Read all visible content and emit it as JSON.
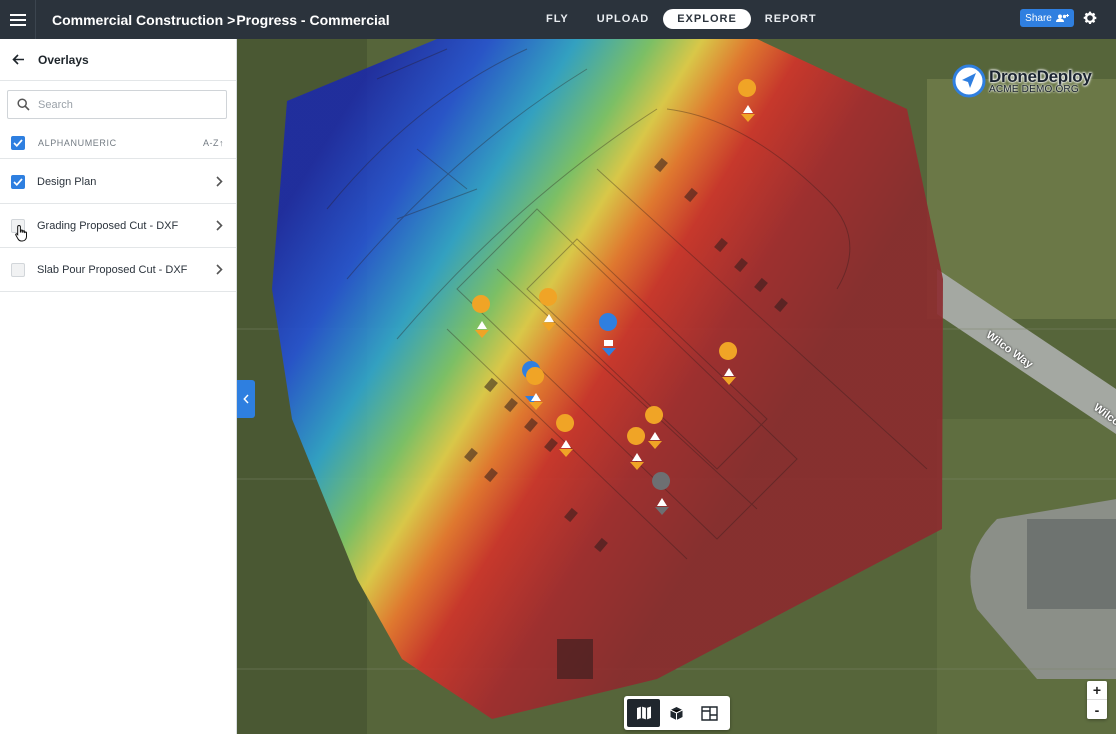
{
  "header": {
    "project": "Commercial Construction",
    "separator": ">",
    "page": "Progress - Commercial",
    "tabs": [
      {
        "label": "FLY",
        "active": false
      },
      {
        "label": "UPLOAD",
        "active": false
      },
      {
        "label": "EXPLORE",
        "active": true
      },
      {
        "label": "REPORT",
        "active": false
      }
    ],
    "share_label": "Share",
    "accent_color": "#2f7fe0"
  },
  "sidebar": {
    "title": "Overlays",
    "search_placeholder": "Search",
    "sort": {
      "label": "ALPHANUMERIC",
      "order": "A-Z",
      "checked": true
    },
    "overlays": [
      {
        "label": "Design Plan",
        "checked": true
      },
      {
        "label": "Grading Proposed Cut - DXF",
        "checked": false
      },
      {
        "label": "Slab Pour Proposed Cut - DXF",
        "checked": false
      }
    ]
  },
  "map": {
    "logo_name": "DroneDeploy",
    "logo_sub": "ACME DEMO.ORG",
    "road_labels": [
      "Wilco Way",
      "Wilco"
    ],
    "zoom_in": "+",
    "zoom_out": "-",
    "view_modes": [
      "map-view",
      "3d-view",
      "plan-view"
    ],
    "marker_icons": [
      "warning-marker",
      "camera-marker",
      "gray-marker"
    ]
  }
}
